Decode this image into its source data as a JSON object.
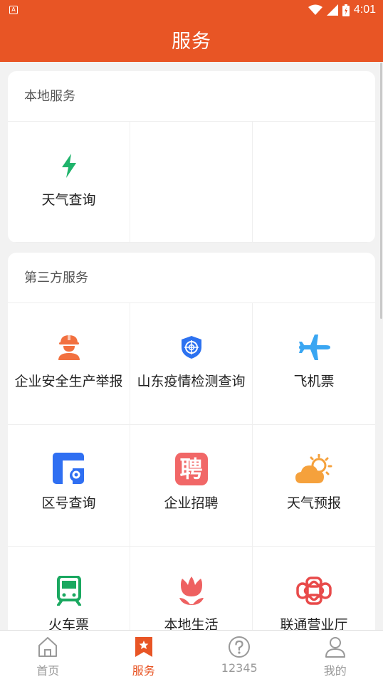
{
  "status_bar": {
    "time": "4:01",
    "notification_icon": "A"
  },
  "header": {
    "title": "服务"
  },
  "local_section": {
    "title": "本地服务",
    "items": [
      {
        "label": "天气查询",
        "icon": "lightning-icon"
      }
    ]
  },
  "third_party_section": {
    "title": "第三方服务",
    "items": [
      {
        "label": "企业安全生产举报",
        "icon": "worker-icon"
      },
      {
        "label": "山东疫情检测查询",
        "icon": "shield-target-icon"
      },
      {
        "label": "飞机票",
        "icon": "airplane-icon"
      },
      {
        "label": "区号查询",
        "icon": "location-map-icon"
      },
      {
        "label": "企业招聘",
        "icon": "recruit-icon",
        "icon_text": "聘"
      },
      {
        "label": "天气预报",
        "icon": "weather-cloud-sun-icon"
      },
      {
        "label": "火车票",
        "icon": "train-icon"
      },
      {
        "label": "本地生活",
        "icon": "tulip-icon"
      },
      {
        "label": "联通营业厅",
        "icon": "unicom-knot-icon"
      }
    ]
  },
  "tab_bar": {
    "tabs": [
      {
        "label": "首页",
        "icon": "home-icon",
        "active": false
      },
      {
        "label": "服务",
        "icon": "bookmark-star-icon",
        "active": true
      },
      {
        "label": "12345",
        "icon": "question-circle-icon",
        "active": false
      },
      {
        "label": "我的",
        "icon": "user-icon",
        "active": false
      }
    ]
  },
  "colors": {
    "accent": "#e85525",
    "lightning": "#1fb36b",
    "worker": "#f2703f",
    "shield": "#2d72f0",
    "airplane": "#3aa6f2",
    "map": "#2f6ff2",
    "recruit": "#f16767",
    "weather": "#f5a13c",
    "train": "#1aa860",
    "tulip": "#ee6060",
    "unicom": "#e84a4a"
  }
}
